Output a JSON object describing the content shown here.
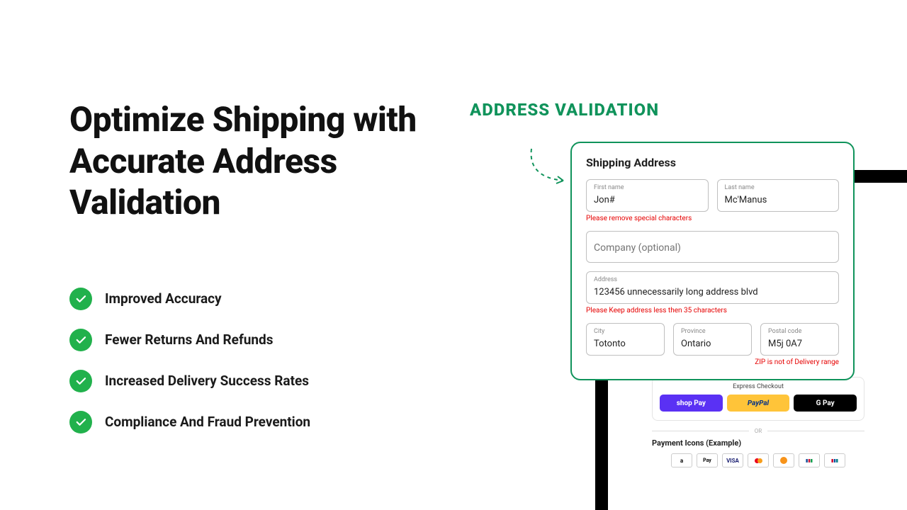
{
  "headline": "Optimize Shipping with Accurate Address Validation",
  "benefits": [
    "Improved Accuracy",
    "Fewer Returns And Refunds",
    "Increased Delivery Success Rates",
    "Compliance And Fraud Prevention"
  ],
  "callout": "ADDRESS VALIDATION",
  "card": {
    "title": "Shipping Address",
    "first_name": {
      "label": "First name",
      "value": "Jon#",
      "error": "Please remove special characters"
    },
    "last_name": {
      "label": "Last name",
      "value": "Mc'Manus"
    },
    "company": {
      "placeholder": "Company (optional)",
      "value": ""
    },
    "address": {
      "label": "Address",
      "value": "123456 unnecessarily long address blvd",
      "error": "Please Keep address less then 35 characters"
    },
    "city": {
      "label": "City",
      "value": "Totonto"
    },
    "province": {
      "label": "Province",
      "value": "Ontario"
    },
    "postal": {
      "label": "Postal code",
      "value": "M5j 0A7",
      "error": "ZIP is not of Delivery range"
    }
  },
  "checkout": {
    "express_label": "Express Checkout",
    "buttons": {
      "shoppay": "shop Pay",
      "paypal": "PayPal",
      "gpay": "G Pay"
    },
    "or": "OR",
    "icons_title": "Payment Icons (Example)",
    "icons": [
      "a",
      "ApplePay",
      "VISA",
      "mastercard",
      "bitcoin",
      "JCB",
      "UnionPay"
    ]
  },
  "colors": {
    "accent": "#10935b",
    "check": "#21b14c",
    "error": "#e60000"
  }
}
